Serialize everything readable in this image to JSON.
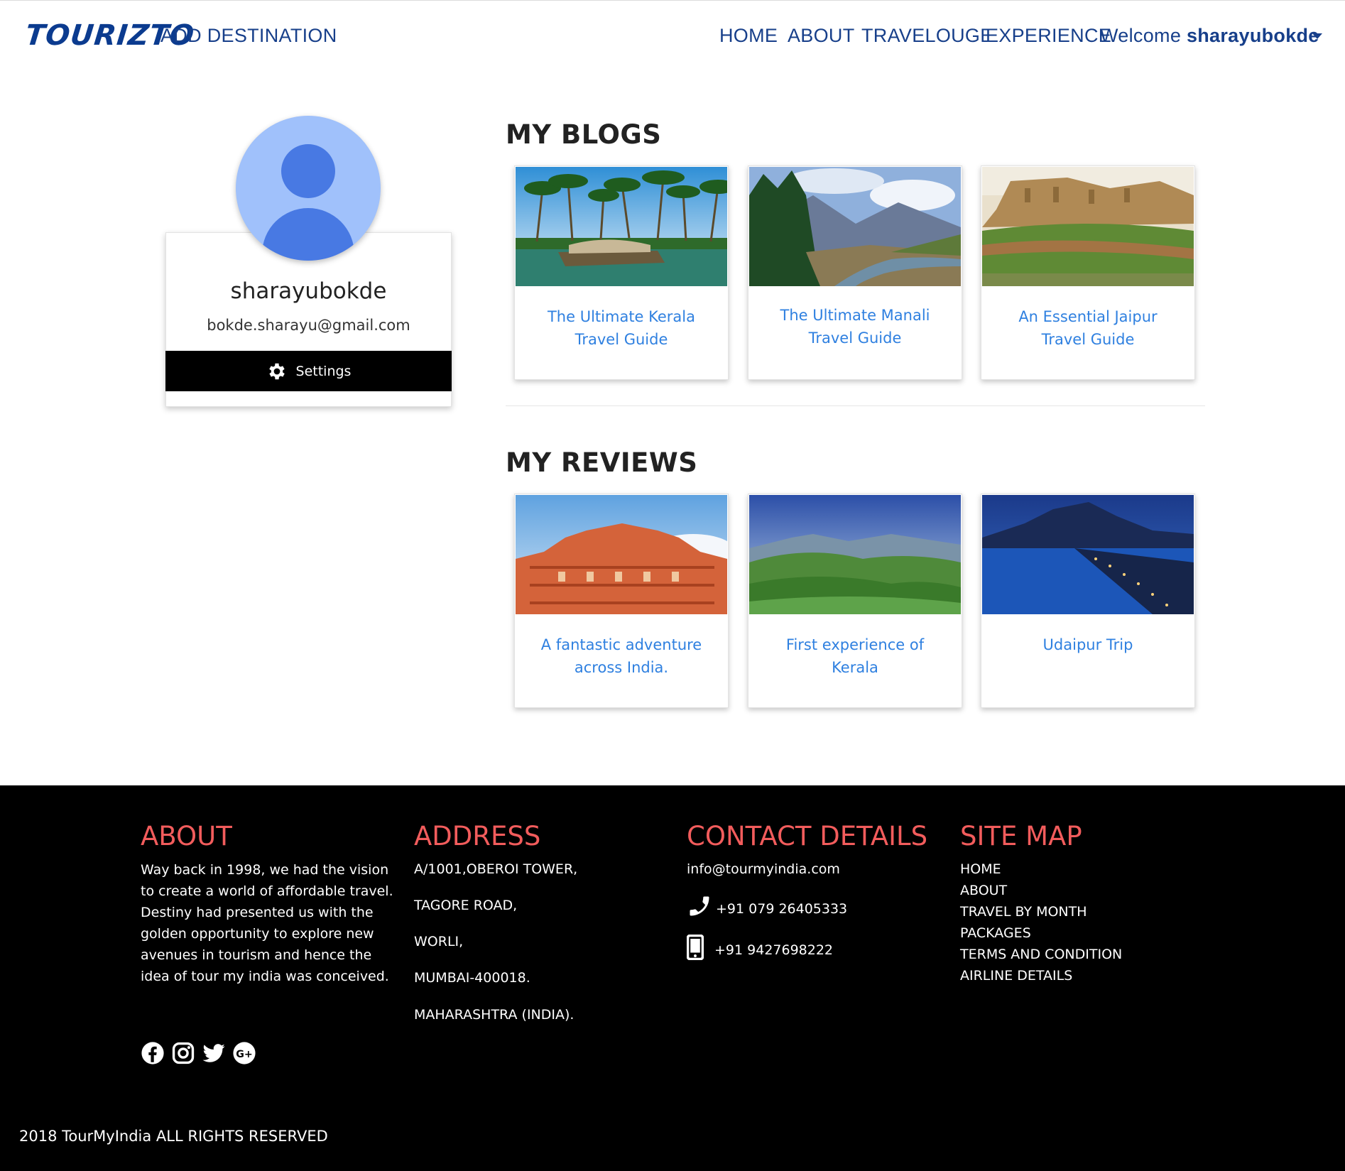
{
  "navbar": {
    "brand": "TOURIZTO",
    "add_destination": "ADD DESTINATION",
    "home": "HOME",
    "about": "ABOUT",
    "travelouge": "TRAVELOUGE",
    "experience": "EXPERIENCE",
    "welcome_prefix": "Welcome",
    "username": "sharayubokde"
  },
  "profile": {
    "name": "sharayubokde",
    "email": "bokde.sharayu@gmail.com",
    "settings_label": "Settings"
  },
  "blogs": {
    "title": "MY BLOGS",
    "items": [
      {
        "title": "The Ultimate Kerala Travel Guide",
        "image": "kerala-backwaters-houseboat"
      },
      {
        "title": "The Ultimate Manali Travel Guide",
        "image": "manali-valley-river"
      },
      {
        "title": "An Essential Jaipur Travel Guide",
        "image": "jaipur-amber-fort"
      }
    ]
  },
  "reviews": {
    "title": "MY REVIEWS",
    "items": [
      {
        "title": "A fantastic adventure across India.",
        "image": "hawa-mahal"
      },
      {
        "title": "First experience of Kerala",
        "image": "kerala-tea-hills"
      },
      {
        "title": "Udaipur Trip",
        "image": "udaipur-lake-night"
      }
    ]
  },
  "footer": {
    "about": {
      "heading": "ABOUT",
      "text": "Way back in 1998, we had the vision to create a world of affordable travel. Destiny had presented us with the golden opportunity to explore new avenues in tourism and hence the idea of tour my india was conceived."
    },
    "address": {
      "heading": "ADDRESS",
      "lines": [
        "A/1001,OBEROI TOWER,",
        "TAGORE ROAD,",
        "WORLI,",
        "MUMBAI-400018.",
        "MAHARASHTRA (INDIA)."
      ]
    },
    "contact": {
      "heading": "CONTACT DETAILS",
      "email": "info@tourmyindia.com",
      "phone": "+91 079 26405333",
      "mobile": "+91 9427698222"
    },
    "sitemap": {
      "heading": "SITE MAP",
      "items": [
        "HOME",
        "ABOUT",
        "TRAVEL BY MONTH",
        "PACKAGES",
        "TERMS AND CONDITION",
        "AIRLINE DETAILS"
      ]
    },
    "social_icons": [
      "facebook-icon",
      "instagram-icon",
      "twitter-icon",
      "google-plus-icon"
    ],
    "copyright": "2018 TourMyIndia ALL RIGHTS RESERVED"
  },
  "colors": {
    "nav_text": "#173f8a",
    "brand": "#0b3b8f",
    "link": "#2f80e0",
    "footer_heading": "#f25c5c",
    "avatar_bg": "#a0c1fb",
    "avatar_fg": "#4879e3"
  }
}
